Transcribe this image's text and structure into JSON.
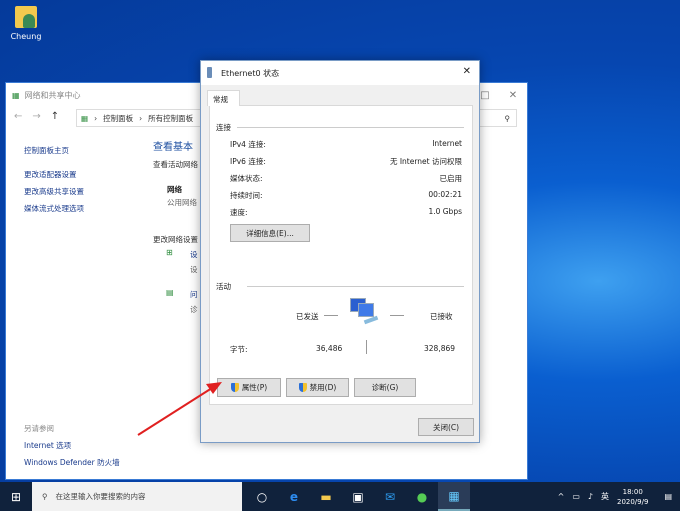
{
  "desktop": {
    "icon_label": "Cheung"
  },
  "bg_window": {
    "title": "网络和共享中心",
    "breadcrumb": [
      "控制面板",
      "所有控制面板"
    ],
    "sidebar": [
      "控制面板主页",
      "更改适配器设置",
      "更改高级共享设置",
      "媒体流式处理选项"
    ],
    "see_also_title": "另请参阅",
    "see_also": [
      "Internet 选项",
      "Windows Defender 防火墙"
    ],
    "main_title": "查看基本",
    "main_sub": "查看活动网络",
    "network_label": "网络",
    "network_type": "公用网络",
    "change_title": "更改网络设置",
    "item1_link": "设",
    "item1_desc": "设",
    "item2_link": "问",
    "item2_desc": "诊"
  },
  "dialog": {
    "title": "Ethernet0 状态",
    "tab": "常规",
    "connection_section": "连接",
    "rows": [
      {
        "label": "IPv4 连接:",
        "value": "Internet"
      },
      {
        "label": "IPv6 连接:",
        "value": "无 Internet 访问权限"
      },
      {
        "label": "媒体状态:",
        "value": "已启用"
      },
      {
        "label": "持续时间:",
        "value": "00:02:21"
      },
      {
        "label": "速度:",
        "value": "1.0 Gbps"
      }
    ],
    "details_button": "详细信息(E)...",
    "activity_section": "活动",
    "sent_label": "已发送",
    "received_label": "已接收",
    "bytes_label": "字节:",
    "bytes_sent": "36,486",
    "bytes_received": "328,869",
    "properties_button": "属性(P)",
    "disable_button": "禁用(D)",
    "diagnose_button": "诊断(G)",
    "close_button": "关闭(C)"
  },
  "taskbar": {
    "search_placeholder": "在这里输入你要搜索的内容",
    "time": "18:00",
    "date": "2020/9/9",
    "ime": "英"
  },
  "colors": {
    "annotation_arrow": "#e02020",
    "taskbar": "#10223c",
    "link": "#1a3b8c"
  }
}
